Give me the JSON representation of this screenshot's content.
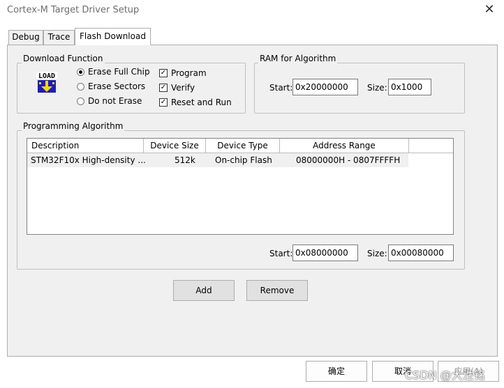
{
  "window": {
    "title": "Cortex-M Target Driver Setup",
    "close_glyph": "✕"
  },
  "tabs": [
    {
      "label": "Debug"
    },
    {
      "label": "Trace"
    },
    {
      "label": "Flash Download"
    }
  ],
  "download_function": {
    "legend": "Download Function",
    "icon_text": "LOAD",
    "radios": [
      {
        "label": "Erase Full Chip",
        "selected": true
      },
      {
        "label": "Erase Sectors",
        "selected": false
      },
      {
        "label": "Do not Erase",
        "selected": false
      }
    ],
    "checks": [
      {
        "label": "Program",
        "checked": true
      },
      {
        "label": "Verify",
        "checked": true
      },
      {
        "label": "Reset and Run",
        "checked": true
      }
    ],
    "check_glyph": "✓"
  },
  "ram": {
    "legend": "RAM for Algorithm",
    "start_label": "Start:",
    "start_value": "0x20000000",
    "size_label": "Size:",
    "size_value": "0x1000"
  },
  "programming_algorithm": {
    "legend": "Programming Algorithm",
    "columns": [
      "Description",
      "Device Size",
      "Device Type",
      "Address Range"
    ],
    "rows": [
      {
        "description": "STM32F10x High-density ...",
        "device_size": "512k",
        "device_type": "On-chip Flash",
        "address_range": "08000000H - 0807FFFFH"
      }
    ],
    "start_label": "Start:",
    "start_value": "0x08000000",
    "size_label": "Size:",
    "size_value": "0x00080000",
    "add_label": "Add",
    "remove_label": "Remove"
  },
  "footer": {
    "ok_label": "确定",
    "cancel_label": "取消",
    "apply_label": "应用(A)"
  },
  "watermark": "CSDN @大泩铭",
  "colors": {
    "dialog_bg": "#f0f0f0",
    "row_bg": "#f0f0f0",
    "border": "#adadad"
  }
}
